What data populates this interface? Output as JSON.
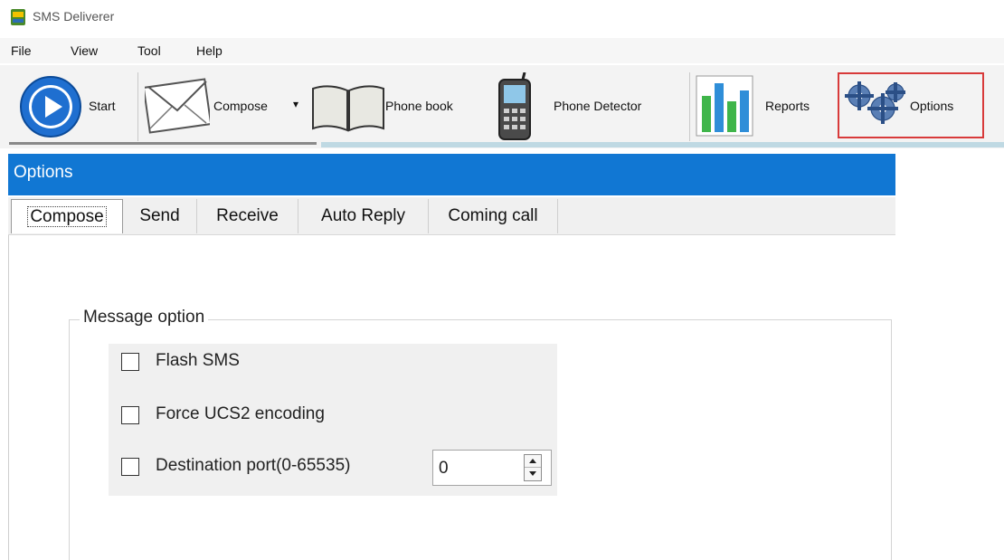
{
  "window": {
    "title": "SMS Deliverer"
  },
  "menu": {
    "items": [
      "File",
      "View",
      "Tool",
      "Help"
    ]
  },
  "toolbar": {
    "start_label": "Start",
    "compose_label": "Compose",
    "compose_dropdown": "▾",
    "phonebook_label": "Phone book",
    "detector_label": "Phone Detector",
    "reports_label": "Reports",
    "options_label": "Options",
    "highlight_color": "#d83a3a"
  },
  "panel": {
    "title": "Options",
    "header_color": "#1177d3"
  },
  "tabs": [
    "Compose",
    "Send",
    "Receive",
    "Auto Reply",
    "Coming call"
  ],
  "active_tab": "Compose",
  "message_option": {
    "legend": "Message option",
    "flash_sms": {
      "label": "Flash SMS",
      "checked": false
    },
    "force_ucs2": {
      "label": "Force UCS2 encoding",
      "checked": false
    },
    "dest_port": {
      "label": "Destination port(0-65535)",
      "checked": false,
      "value": "0"
    }
  },
  "icons": {
    "start": "play-circle-icon",
    "compose": "envelope-icon",
    "phonebook": "open-book-icon",
    "detector": "mobile-phone-icon",
    "reports": "bar-chart-icon",
    "options": "gears-icon"
  }
}
